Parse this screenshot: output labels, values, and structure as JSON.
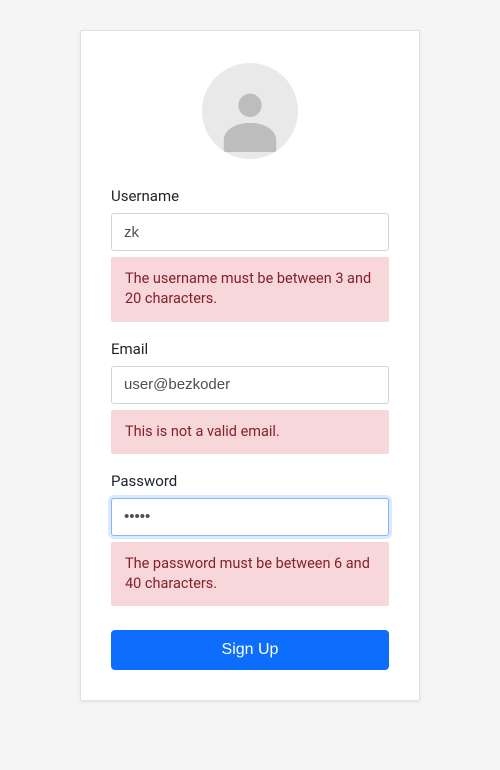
{
  "form": {
    "username": {
      "label": "Username",
      "value": "zk",
      "error": "The username must be between 3 and 20 characters."
    },
    "email": {
      "label": "Email",
      "value": "user@bezkoder",
      "error": "This is not a valid email."
    },
    "password": {
      "label": "Password",
      "value": "•••••",
      "error": "The password must be between 6 and 40 characters."
    },
    "submit_label": "Sign Up"
  }
}
